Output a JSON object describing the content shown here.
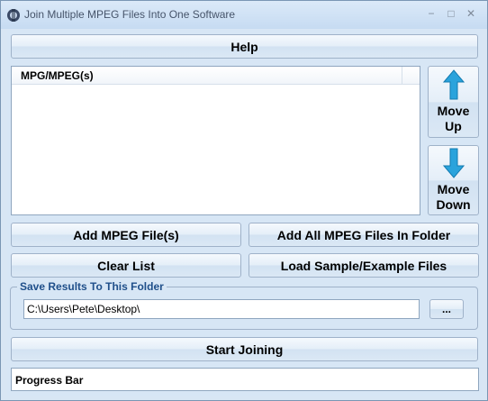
{
  "window": {
    "title": "Join Multiple MPEG Files Into One Software",
    "controls": {
      "minimize": "−",
      "maximize": "□",
      "close": "✕"
    }
  },
  "buttons": {
    "help": "Help",
    "move_up_line1": "Move",
    "move_up_line2": "Up",
    "move_down_line1": "Move",
    "move_down_line2": "Down",
    "add_files": "Add MPEG File(s)",
    "add_folder": "Add All MPEG Files In Folder",
    "clear_list": "Clear List",
    "load_sample": "Load Sample/Example Files",
    "browse": "...",
    "start": "Start Joining"
  },
  "file_list": {
    "column_header": "MPG/MPEG(s)",
    "items": []
  },
  "output": {
    "group_label": "Save Results To This Folder",
    "path": "C:\\Users\\Pete\\Desktop\\"
  },
  "progress": {
    "label": "Progress Bar",
    "value": 0
  },
  "colors": {
    "arrow": "#2aa3dc",
    "window_bg": "#d7e6f5",
    "group_label": "#1f4f8a"
  }
}
